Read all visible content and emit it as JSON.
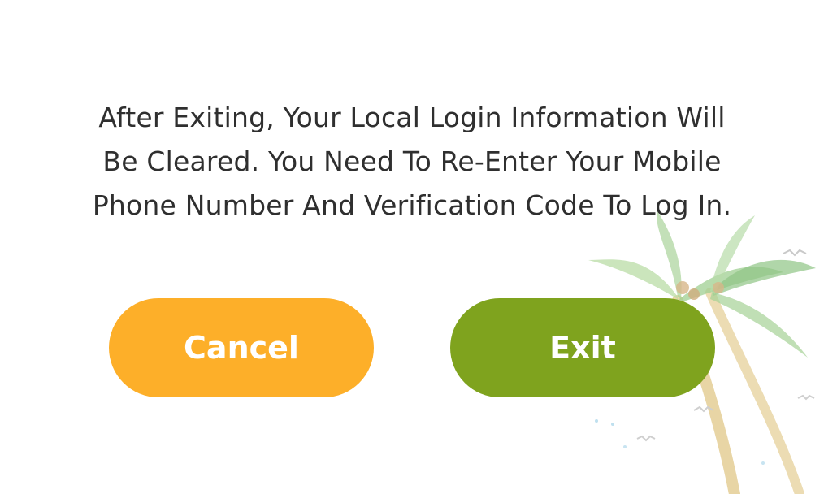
{
  "dialog": {
    "message_lines": [
      "After Exiting, Your Local Login Information Will",
      "Be Cleared. You Need To Re-Enter Your Mobile",
      "Phone Number And Verification Code To Log In."
    ]
  },
  "buttons": {
    "cancel_label": "Cancel",
    "exit_label": "Exit"
  },
  "colors": {
    "cancel": "#FDAF29",
    "exit": "#7FA31E",
    "text": "#2f2f2f"
  },
  "decoration": {
    "icon": "palm-tree-illustration"
  }
}
